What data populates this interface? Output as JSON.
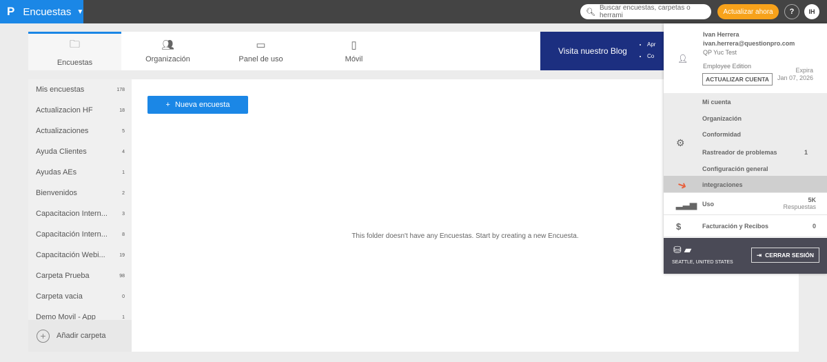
{
  "topbar": {
    "logo": "P",
    "app": "Encuestas",
    "search_placeholder": "Buscar encuestas, carpetas o herrami",
    "upgrade": "Actualizar ahora",
    "help": "?",
    "avatar": "IH"
  },
  "tabs": [
    {
      "label": "Encuestas",
      "icon": "folder-icon"
    },
    {
      "label": "Organización",
      "icon": "add-user-icon"
    },
    {
      "label": "Panel de uso",
      "icon": "monitor-icon"
    },
    {
      "label": "Móvil",
      "icon": "mobile-icon"
    }
  ],
  "blog": {
    "title": "Visita nuestro Blog",
    "bullets": [
      "Apr",
      "Co"
    ]
  },
  "sidebar": {
    "items": [
      {
        "label": "Mis encuestas",
        "count": "178"
      },
      {
        "label": "Actualizacion HF",
        "count": "18"
      },
      {
        "label": "Actualizaciones",
        "count": "5"
      },
      {
        "label": "Ayuda Clientes",
        "count": "4"
      },
      {
        "label": "Ayudas AEs",
        "count": "1"
      },
      {
        "label": "Bienvenidos",
        "count": "2"
      },
      {
        "label": "Capacitacion Intern...",
        "count": "3"
      },
      {
        "label": "Capacitación Intern...",
        "count": "8"
      },
      {
        "label": "Capacitación Webi...",
        "count": "19"
      },
      {
        "label": "Carpeta Prueba",
        "count": "98"
      },
      {
        "label": "Carpeta vacia",
        "count": "0"
      },
      {
        "label": "Demo Movil - App",
        "count": "1"
      }
    ],
    "add_folder": "Añadir carpeta"
  },
  "main": {
    "new_button": "Nueva encuesta",
    "empty": "This folder doesn't have any Encuestas. Start by creating a new Encuesta."
  },
  "account": {
    "name": "Ivan Herrera",
    "email": "ivan.herrera@questionpro.com",
    "org": "QP Yuc Test",
    "edition": "Employee Edition",
    "upgrade": "ACTUALIZAR CUENTA",
    "expires_label": "Expira",
    "expires_date": "Jan 07, 2026",
    "settings": [
      {
        "label": "Mi cuenta",
        "value": ""
      },
      {
        "label": "Organización",
        "value": ""
      },
      {
        "label": "Conformidad",
        "value": ""
      },
      {
        "label": "Rastreador de problemas",
        "value": "1"
      },
      {
        "label": "Configuración general",
        "value": ""
      },
      {
        "label": "integraciones",
        "value": ""
      }
    ],
    "usage": {
      "label": "Uso",
      "value": "5K",
      "unit": "Respuestas"
    },
    "billing": {
      "label": "Facturación y Recibos",
      "value": "0"
    },
    "location": "SEATTLE, UNITED STATES",
    "logout": "CERRAR SESIÓN"
  },
  "colors": {
    "brand": "#1b87e6",
    "upgrade": "#f7a21b",
    "blog": "#1c2f80",
    "footer": "#4a4a56",
    "arrow": "#e8603c"
  }
}
